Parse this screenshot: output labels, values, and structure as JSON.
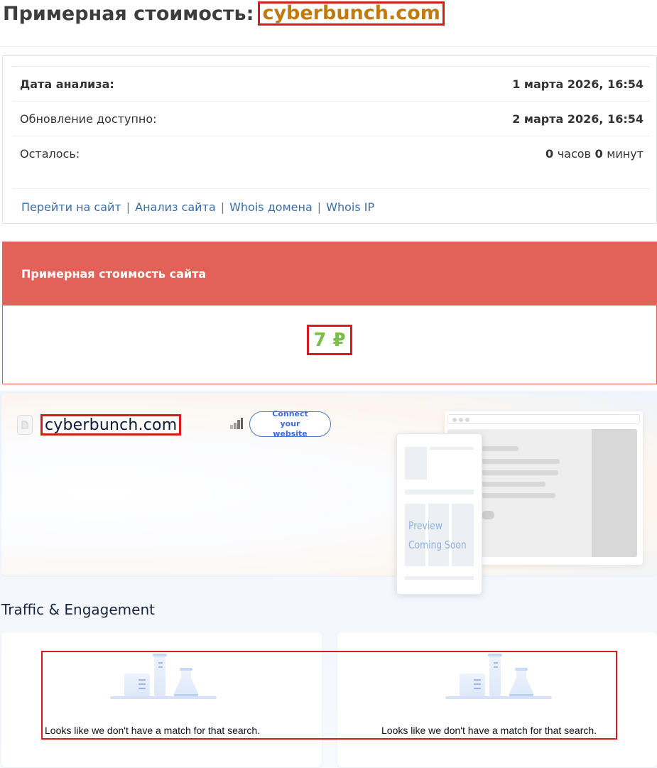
{
  "header": {
    "title_prefix": "Примерная стоимость:",
    "domain": "cyberbunch.com"
  },
  "info": {
    "rows": [
      {
        "label": "Дата анализа:",
        "value": "1 марта 2026, 16:54"
      },
      {
        "label": "Обновление доступно:",
        "value": "2 марта 2026, 16:54"
      },
      {
        "label": "Осталось:",
        "hours": "0",
        "hours_unit": "часов",
        "minutes": "0",
        "minutes_unit": "минут"
      }
    ],
    "links": [
      "Перейти на сайт",
      "Анализ сайта",
      "Whois домена",
      "Whois IP"
    ],
    "separator": "|"
  },
  "price": {
    "heading": "Примерная стоимость сайта",
    "value": "7 ₽",
    "value_color": "#7bbd4c",
    "heading_bg": "#e2625a"
  },
  "similarweb": {
    "domain": "cyberbunch.com",
    "connect_label": "Connect your website",
    "preview_line1": "Preview",
    "preview_line2": "Coming Soon",
    "traffic_title": "Traffic & Engagement",
    "empty_message_left": "Looks like we don't have a match for that search.",
    "empty_message_right": "Looks like we don't have a match for that search.",
    "accent": "#3e6ddb"
  }
}
